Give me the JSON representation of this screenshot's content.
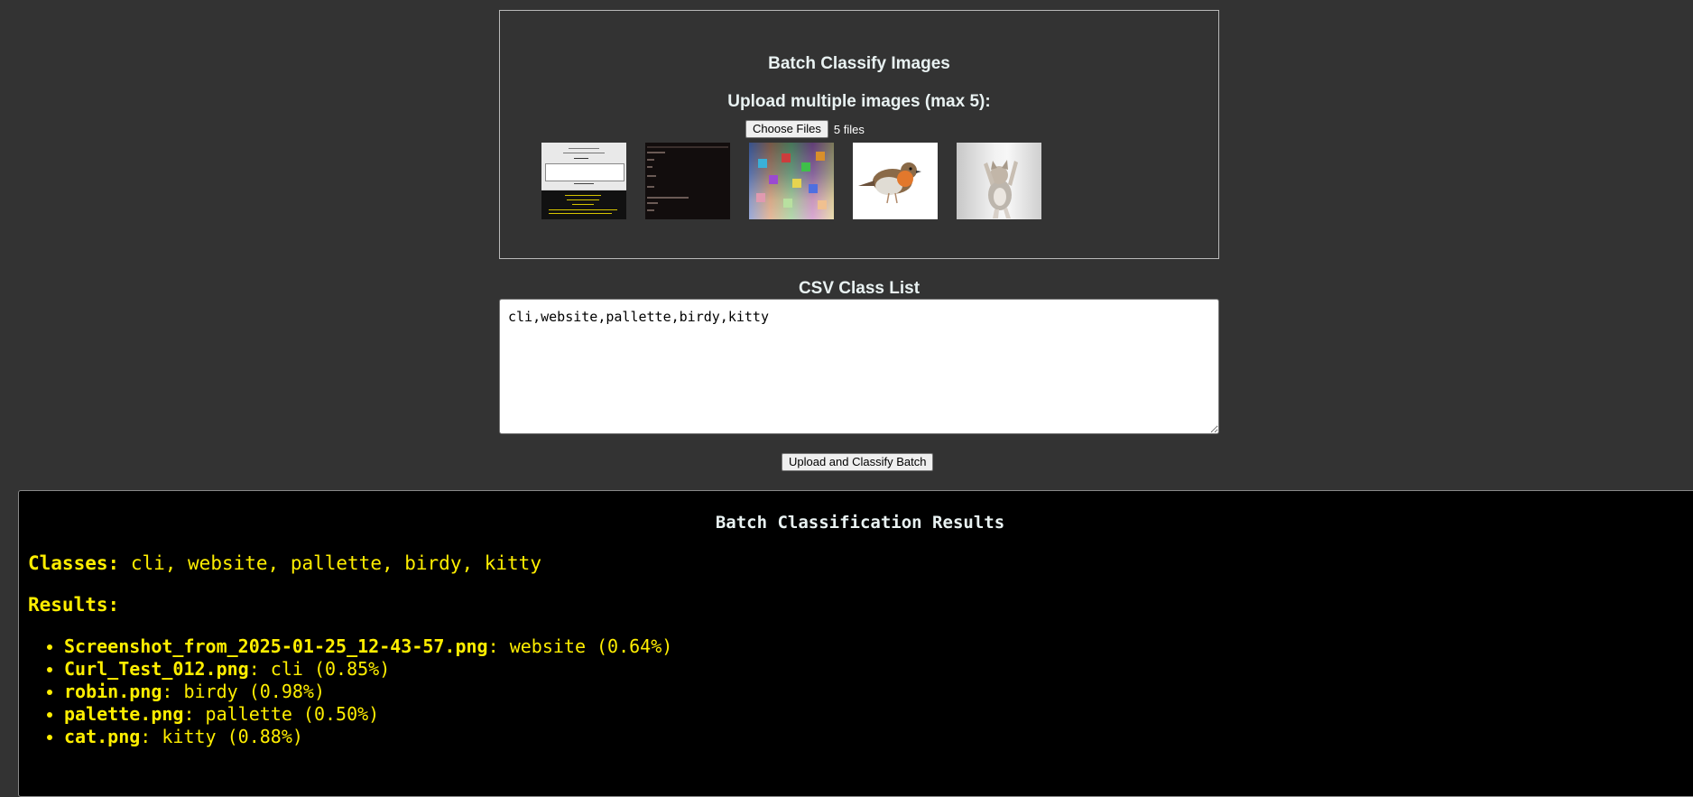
{
  "upload_panel": {
    "title": "Batch Classify Images",
    "subtitle": "Upload multiple images (max 5):",
    "choose_files_label": "Choose Files",
    "files_status": "5 files",
    "previews": [
      {
        "icon": "website-screenshot-thumbnail"
      },
      {
        "icon": "terminal-screenshot-thumbnail"
      },
      {
        "icon": "color-palette-thumbnail"
      },
      {
        "icon": "robin-bird-thumbnail"
      },
      {
        "icon": "cat-thumbnail"
      }
    ]
  },
  "csv": {
    "label": "CSV Class List",
    "value": "cli,website,pallette,birdy,kitty"
  },
  "submit": {
    "label": "Upload and Classify Batch"
  },
  "results": {
    "title": "Batch Classification Results",
    "classes_label": "Classes:",
    "classes_value": "cli, website, pallette, birdy, kitty",
    "results_label": "Results:",
    "items": [
      {
        "file": "Screenshot_from_2025-01-25_12-43-57.png",
        "text": ": website (0.64%)"
      },
      {
        "file": "Curl_Test_012.png",
        "text": ": cli (0.85%)"
      },
      {
        "file": "robin.png",
        "text": ": birdy (0.98%)"
      },
      {
        "file": "palette.png",
        "text": ": pallette (0.50%)"
      },
      {
        "file": "cat.png",
        "text": ": kitty (0.88%)"
      }
    ]
  },
  "colors": {
    "page_bg": "#333333",
    "results_bg": "#000000",
    "results_text": "#ffee00",
    "heading_text": "#e9f2f2"
  }
}
